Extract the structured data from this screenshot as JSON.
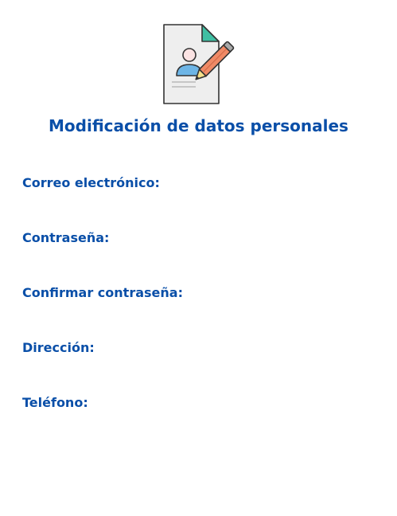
{
  "header": {
    "icon": "edit-profile-document-icon",
    "title": "Modificación de datos personales"
  },
  "form": {
    "labels": [
      "Correo electrónico:",
      "Contraseña:",
      "Confirmar contraseña:",
      "Dirección:",
      "Teléfono:"
    ]
  },
  "colors": {
    "accent": "#0a4fa8",
    "icon_teal": "#3fbfa3",
    "icon_pencil": "#f08a66",
    "icon_person": "#6db5e6"
  }
}
